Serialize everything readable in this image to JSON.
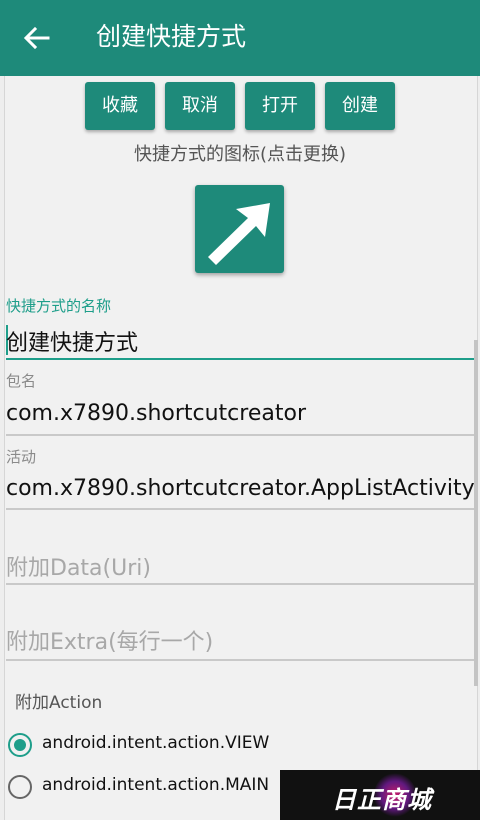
{
  "header": {
    "title": "创建快捷方式"
  },
  "buttons": {
    "favorite": "收藏",
    "cancel": "取消",
    "open": "打开",
    "create": "创建"
  },
  "icon_caption": "快捷方式的图标(点击更换)",
  "fields": {
    "name": {
      "label": "快捷方式的名称",
      "value": "创建快捷方式"
    },
    "package": {
      "label": "包名",
      "value": "com.x7890.shortcutcreator"
    },
    "activity": {
      "label": "活动",
      "value": "com.x7890.shortcutcreator.AppListActivity"
    },
    "data_uri": {
      "placeholder": "附加Data(Uri)"
    },
    "extra": {
      "placeholder": "附加Extra(每行一个)"
    }
  },
  "action": {
    "label": "附加Action",
    "options": [
      {
        "label": "android.intent.action.VIEW",
        "selected": true
      },
      {
        "label": "android.intent.action.MAIN",
        "selected": false
      }
    ]
  },
  "watermark": {
    "text": "日正商城"
  },
  "colors": {
    "accent": "#1e8a7a",
    "accent_light": "#1e9e8a",
    "background": "#eeeeee"
  },
  "icons": {
    "back": "arrow-left",
    "shortcut": "diagonal-arrow"
  }
}
